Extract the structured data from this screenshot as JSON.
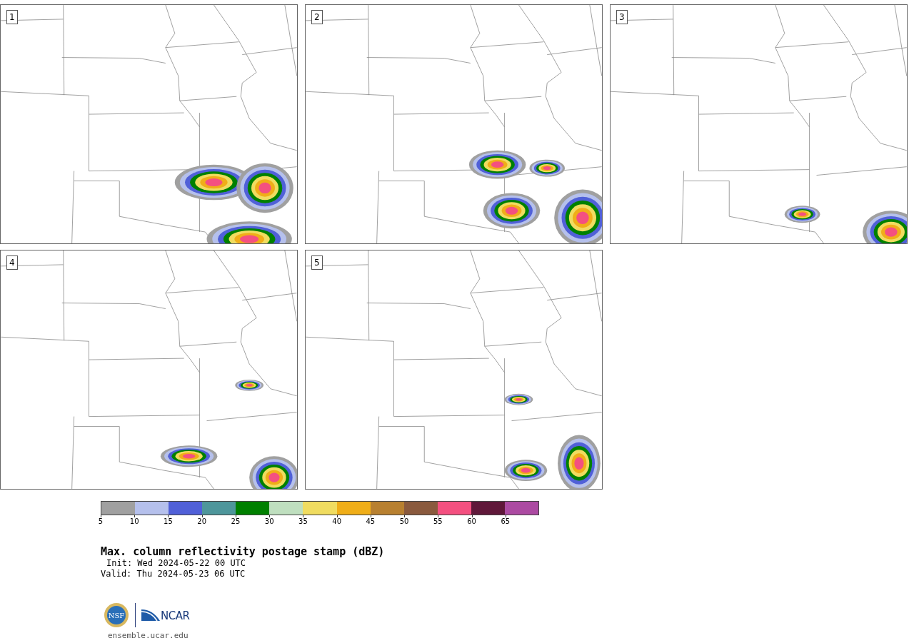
{
  "panels": [
    {
      "label": "1"
    },
    {
      "label": "2"
    },
    {
      "label": "3"
    },
    {
      "label": "4"
    },
    {
      "label": "5"
    }
  ],
  "colorbar": {
    "segments": [
      {
        "tick": "5",
        "color": "#a0a0a0"
      },
      {
        "tick": "10",
        "color": "#b5c0ec"
      },
      {
        "tick": "15",
        "color": "#5060d8"
      },
      {
        "tick": "20",
        "color": "#4e969b"
      },
      {
        "tick": "25",
        "color": "#008000"
      },
      {
        "tick": "30",
        "color": "#bfdfbf"
      },
      {
        "tick": "35",
        "color": "#f0dc60"
      },
      {
        "tick": "40",
        "color": "#f0ae18"
      },
      {
        "tick": "45",
        "color": "#b88030"
      },
      {
        "tick": "50",
        "color": "#8a5a3e"
      },
      {
        "tick": "55",
        "color": "#f45080"
      },
      {
        "tick": "60",
        "color": "#60183a"
      },
      {
        "tick": "65",
        "color": "#ac4aa2"
      }
    ]
  },
  "title": "Max. column reflectivity postage stamp (dBZ)",
  "init": "Init: Wed 2024-05-22 00 UTC",
  "valid": "Valid: Thu 2024-05-23 06 UTC",
  "logo": {
    "seal_text": "NSF",
    "wordmark": "NCAR"
  },
  "footer_link": "ensemble.ucar.edu"
}
